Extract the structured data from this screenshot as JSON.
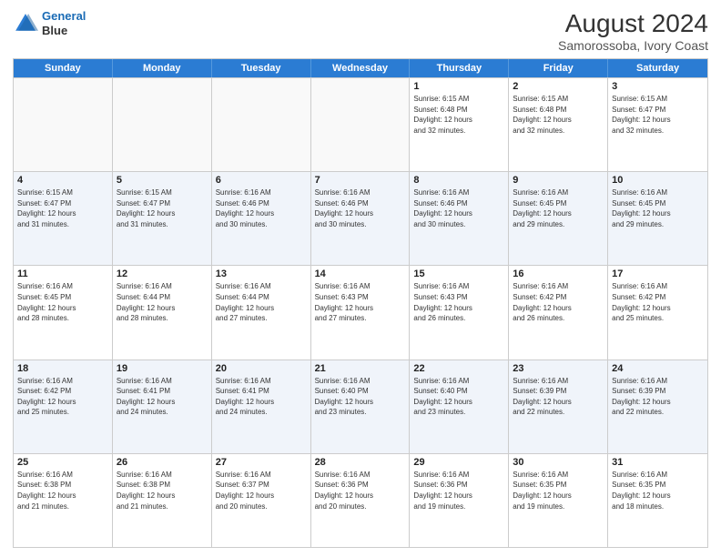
{
  "header": {
    "logo_line1": "General",
    "logo_line2": "Blue",
    "main_title": "August 2024",
    "subtitle": "Samorossoba, Ivory Coast"
  },
  "weekdays": [
    "Sunday",
    "Monday",
    "Tuesday",
    "Wednesday",
    "Thursday",
    "Friday",
    "Saturday"
  ],
  "weeks": [
    [
      {
        "day": "",
        "info": "",
        "empty": true
      },
      {
        "day": "",
        "info": "",
        "empty": true
      },
      {
        "day": "",
        "info": "",
        "empty": true
      },
      {
        "day": "",
        "info": "",
        "empty": true
      },
      {
        "day": "1",
        "info": "Sunrise: 6:15 AM\nSunset: 6:48 PM\nDaylight: 12 hours\nand 32 minutes.",
        "empty": false
      },
      {
        "day": "2",
        "info": "Sunrise: 6:15 AM\nSunset: 6:48 PM\nDaylight: 12 hours\nand 32 minutes.",
        "empty": false
      },
      {
        "day": "3",
        "info": "Sunrise: 6:15 AM\nSunset: 6:47 PM\nDaylight: 12 hours\nand 32 minutes.",
        "empty": false
      }
    ],
    [
      {
        "day": "4",
        "info": "Sunrise: 6:15 AM\nSunset: 6:47 PM\nDaylight: 12 hours\nand 31 minutes.",
        "empty": false
      },
      {
        "day": "5",
        "info": "Sunrise: 6:15 AM\nSunset: 6:47 PM\nDaylight: 12 hours\nand 31 minutes.",
        "empty": false
      },
      {
        "day": "6",
        "info": "Sunrise: 6:16 AM\nSunset: 6:46 PM\nDaylight: 12 hours\nand 30 minutes.",
        "empty": false
      },
      {
        "day": "7",
        "info": "Sunrise: 6:16 AM\nSunset: 6:46 PM\nDaylight: 12 hours\nand 30 minutes.",
        "empty": false
      },
      {
        "day": "8",
        "info": "Sunrise: 6:16 AM\nSunset: 6:46 PM\nDaylight: 12 hours\nand 30 minutes.",
        "empty": false
      },
      {
        "day": "9",
        "info": "Sunrise: 6:16 AM\nSunset: 6:45 PM\nDaylight: 12 hours\nand 29 minutes.",
        "empty": false
      },
      {
        "day": "10",
        "info": "Sunrise: 6:16 AM\nSunset: 6:45 PM\nDaylight: 12 hours\nand 29 minutes.",
        "empty": false
      }
    ],
    [
      {
        "day": "11",
        "info": "Sunrise: 6:16 AM\nSunset: 6:45 PM\nDaylight: 12 hours\nand 28 minutes.",
        "empty": false
      },
      {
        "day": "12",
        "info": "Sunrise: 6:16 AM\nSunset: 6:44 PM\nDaylight: 12 hours\nand 28 minutes.",
        "empty": false
      },
      {
        "day": "13",
        "info": "Sunrise: 6:16 AM\nSunset: 6:44 PM\nDaylight: 12 hours\nand 27 minutes.",
        "empty": false
      },
      {
        "day": "14",
        "info": "Sunrise: 6:16 AM\nSunset: 6:43 PM\nDaylight: 12 hours\nand 27 minutes.",
        "empty": false
      },
      {
        "day": "15",
        "info": "Sunrise: 6:16 AM\nSunset: 6:43 PM\nDaylight: 12 hours\nand 26 minutes.",
        "empty": false
      },
      {
        "day": "16",
        "info": "Sunrise: 6:16 AM\nSunset: 6:42 PM\nDaylight: 12 hours\nand 26 minutes.",
        "empty": false
      },
      {
        "day": "17",
        "info": "Sunrise: 6:16 AM\nSunset: 6:42 PM\nDaylight: 12 hours\nand 25 minutes.",
        "empty": false
      }
    ],
    [
      {
        "day": "18",
        "info": "Sunrise: 6:16 AM\nSunset: 6:42 PM\nDaylight: 12 hours\nand 25 minutes.",
        "empty": false
      },
      {
        "day": "19",
        "info": "Sunrise: 6:16 AM\nSunset: 6:41 PM\nDaylight: 12 hours\nand 24 minutes.",
        "empty": false
      },
      {
        "day": "20",
        "info": "Sunrise: 6:16 AM\nSunset: 6:41 PM\nDaylight: 12 hours\nand 24 minutes.",
        "empty": false
      },
      {
        "day": "21",
        "info": "Sunrise: 6:16 AM\nSunset: 6:40 PM\nDaylight: 12 hours\nand 23 minutes.",
        "empty": false
      },
      {
        "day": "22",
        "info": "Sunrise: 6:16 AM\nSunset: 6:40 PM\nDaylight: 12 hours\nand 23 minutes.",
        "empty": false
      },
      {
        "day": "23",
        "info": "Sunrise: 6:16 AM\nSunset: 6:39 PM\nDaylight: 12 hours\nand 22 minutes.",
        "empty": false
      },
      {
        "day": "24",
        "info": "Sunrise: 6:16 AM\nSunset: 6:39 PM\nDaylight: 12 hours\nand 22 minutes.",
        "empty": false
      }
    ],
    [
      {
        "day": "25",
        "info": "Sunrise: 6:16 AM\nSunset: 6:38 PM\nDaylight: 12 hours\nand 21 minutes.",
        "empty": false
      },
      {
        "day": "26",
        "info": "Sunrise: 6:16 AM\nSunset: 6:38 PM\nDaylight: 12 hours\nand 21 minutes.",
        "empty": false
      },
      {
        "day": "27",
        "info": "Sunrise: 6:16 AM\nSunset: 6:37 PM\nDaylight: 12 hours\nand 20 minutes.",
        "empty": false
      },
      {
        "day": "28",
        "info": "Sunrise: 6:16 AM\nSunset: 6:36 PM\nDaylight: 12 hours\nand 20 minutes.",
        "empty": false
      },
      {
        "day": "29",
        "info": "Sunrise: 6:16 AM\nSunset: 6:36 PM\nDaylight: 12 hours\nand 19 minutes.",
        "empty": false
      },
      {
        "day": "30",
        "info": "Sunrise: 6:16 AM\nSunset: 6:35 PM\nDaylight: 12 hours\nand 19 minutes.",
        "empty": false
      },
      {
        "day": "31",
        "info": "Sunrise: 6:16 AM\nSunset: 6:35 PM\nDaylight: 12 hours\nand 18 minutes.",
        "empty": false
      }
    ]
  ]
}
